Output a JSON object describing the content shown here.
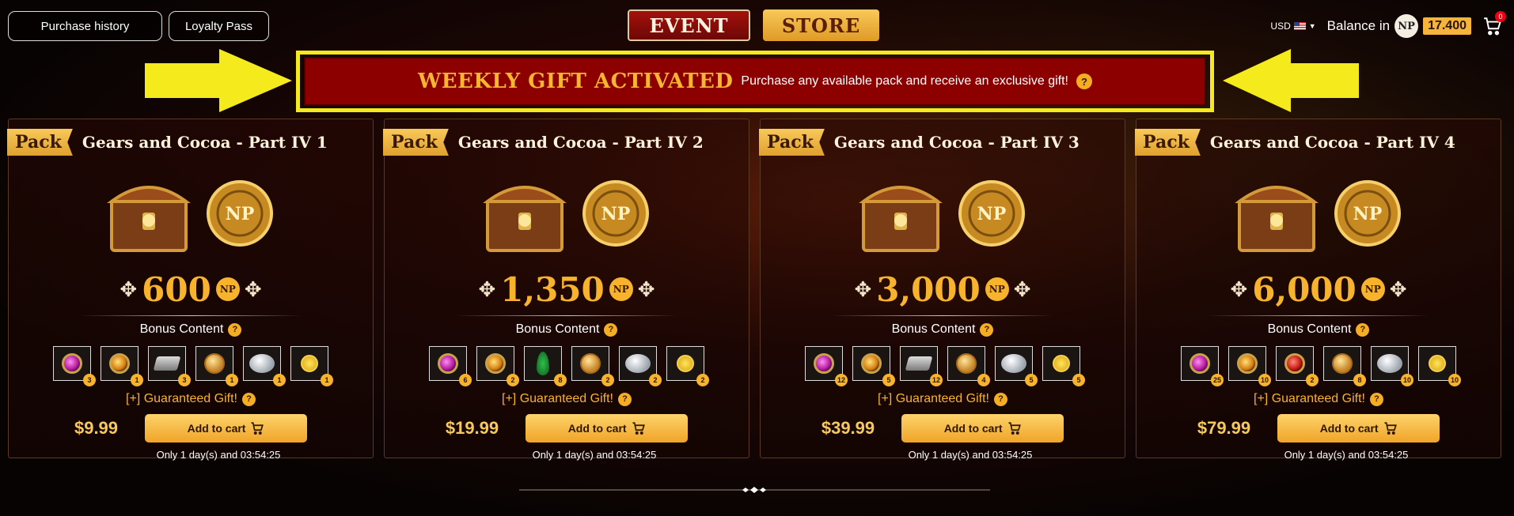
{
  "topnav": {
    "purchase_history": "Purchase history",
    "loyalty_pass": "Loyalty Pass"
  },
  "tabs": {
    "event": "EVENT",
    "store": "STORE"
  },
  "account": {
    "currency": "USD",
    "balance_label": "Balance in",
    "np_symbol": "NP",
    "balance_value": "17.400",
    "cart_count": "0"
  },
  "banner": {
    "title": "WEEKLY GIFT ACTIVATED",
    "text": "Purchase any available pack and receive an exclusive gift!",
    "help": "?"
  },
  "labels": {
    "pack": "Pack",
    "np": "NP",
    "bonus_content": "Bonus Content",
    "guaranteed_gift": "[+] Guaranteed Gift!",
    "add_to_cart": "Add to cart",
    "help": "?"
  },
  "packs": [
    {
      "title": "Gears and Cocoa - Part IV 1",
      "np_amount": "600",
      "price": "$9.99",
      "timer": "Only 1 day(s) and 03:54:25",
      "items": [
        {
          "icon": "pink-gem",
          "count": "3"
        },
        {
          "icon": "amber-gem",
          "count": "1"
        },
        {
          "icon": "ingot",
          "count": "3"
        },
        {
          "icon": "gold-coin",
          "count": "1"
        },
        {
          "icon": "silver-token",
          "count": "1"
        },
        {
          "icon": "ribbon-medal",
          "count": "1"
        }
      ]
    },
    {
      "title": "Gears and Cocoa - Part IV 2",
      "np_amount": "1,350",
      "price": "$19.99",
      "timer": "Only 1 day(s) and 03:54:25",
      "items": [
        {
          "icon": "pink-gem",
          "count": "6"
        },
        {
          "icon": "amber-gem",
          "count": "2"
        },
        {
          "icon": "green-leaf",
          "count": "8"
        },
        {
          "icon": "gold-coin",
          "count": "2"
        },
        {
          "icon": "silver-token",
          "count": "2"
        },
        {
          "icon": "ribbon-medal",
          "count": "2"
        }
      ]
    },
    {
      "title": "Gears and Cocoa - Part IV 3",
      "np_amount": "3,000",
      "price": "$39.99",
      "timer": "Only 1 day(s) and 03:54:25",
      "items": [
        {
          "icon": "pink-gem",
          "count": "12"
        },
        {
          "icon": "amber-gem",
          "count": "5"
        },
        {
          "icon": "ingot",
          "count": "12"
        },
        {
          "icon": "gold-coin",
          "count": "4"
        },
        {
          "icon": "silver-token",
          "count": "5"
        },
        {
          "icon": "ribbon-medal",
          "count": "5"
        }
      ]
    },
    {
      "title": "Gears and Cocoa - Part IV 4",
      "np_amount": "6,000",
      "price": "$79.99",
      "timer": "Only 1 day(s) and 03:54:25",
      "items": [
        {
          "icon": "pink-gem",
          "count": "25"
        },
        {
          "icon": "amber-gem",
          "count": "10"
        },
        {
          "icon": "red-gem",
          "count": "2"
        },
        {
          "icon": "gold-coin",
          "count": "8"
        },
        {
          "icon": "silver-token",
          "count": "10"
        },
        {
          "icon": "ribbon-medal",
          "count": "10"
        }
      ]
    }
  ],
  "colors": {
    "accent_gold": "#f7b32b",
    "banner_red": "#8c0000",
    "highlight_yellow": "#f5ea1b"
  }
}
